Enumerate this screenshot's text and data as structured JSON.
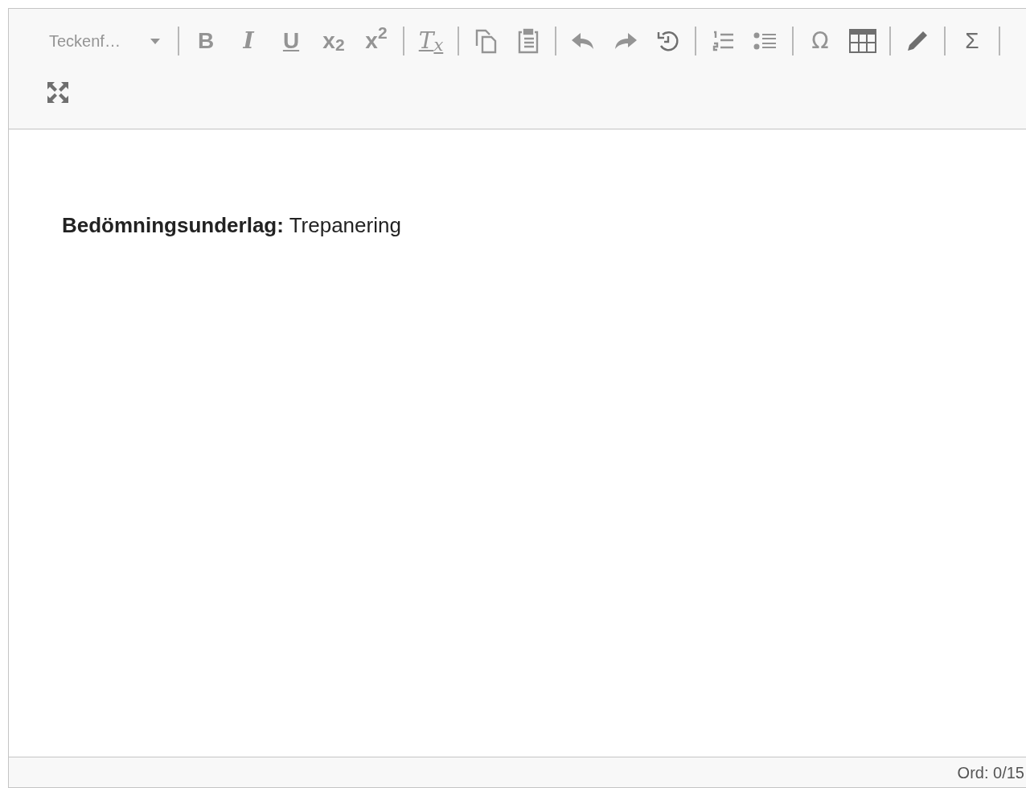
{
  "toolbar": {
    "rows": [
      [
        {
          "kind": "dropdown",
          "label": "Teckenf…",
          "disabled": true
        },
        {
          "kind": "separator"
        },
        {
          "kind": "text",
          "label": "B",
          "disabled": true
        },
        {
          "kind": "text",
          "label": "I",
          "disabled": true
        },
        {
          "kind": "text",
          "label": "U",
          "disabled": true
        },
        {
          "kind": "text",
          "label": "x$_{2}$",
          "disabled": true
        },
        {
          "kind": "text",
          "label": "x$^{2}$",
          "disabled": true
        },
        {
          "kind": "separator"
        },
        {
          "kind": "text",
          "label": "T$_{x}$",
          "disabled": true
        },
        {
          "kind": "separator"
        },
        {
          "kind": "icon",
          "disabled": true
        },
        {
          "kind": "icon",
          "disabled": true
        },
        {
          "kind": "separator"
        },
        {
          "kind": "icon",
          "disabled": true
        },
        {
          "kind": "icon",
          "disabled": true
        },
        {
          "kind": "icon",
          "disabled": false
        },
        {
          "kind": "separator"
        },
        {
          "kind": "icon",
          "disabled": true
        },
        {
          "kind": "icon",
          "disabled": true
        },
        {
          "kind": "separator"
        },
        {
          "kind": "text",
          "label": "Ω",
          "disabled": true
        },
        {
          "kind": "icon",
          "disabled": false
        },
        {
          "kind": "separator"
        },
        {
          "kind": "icon",
          "disabled": false
        },
        {
          "kind": "separator"
        },
        {
          "kind": "text",
          "label": "Σ",
          "disabled": false
        },
        {
          "kind": "separator"
        }
      ],
      [
        {
          "kind": "icon",
          "disabled": false
        }
      ]
    ]
  },
  "content": {
    "paragraph": "**Bedömningsunderlag:** Trepanering"
  },
  "status_bar": {
    "word_count": "Ord: 0/15"
  }
}
